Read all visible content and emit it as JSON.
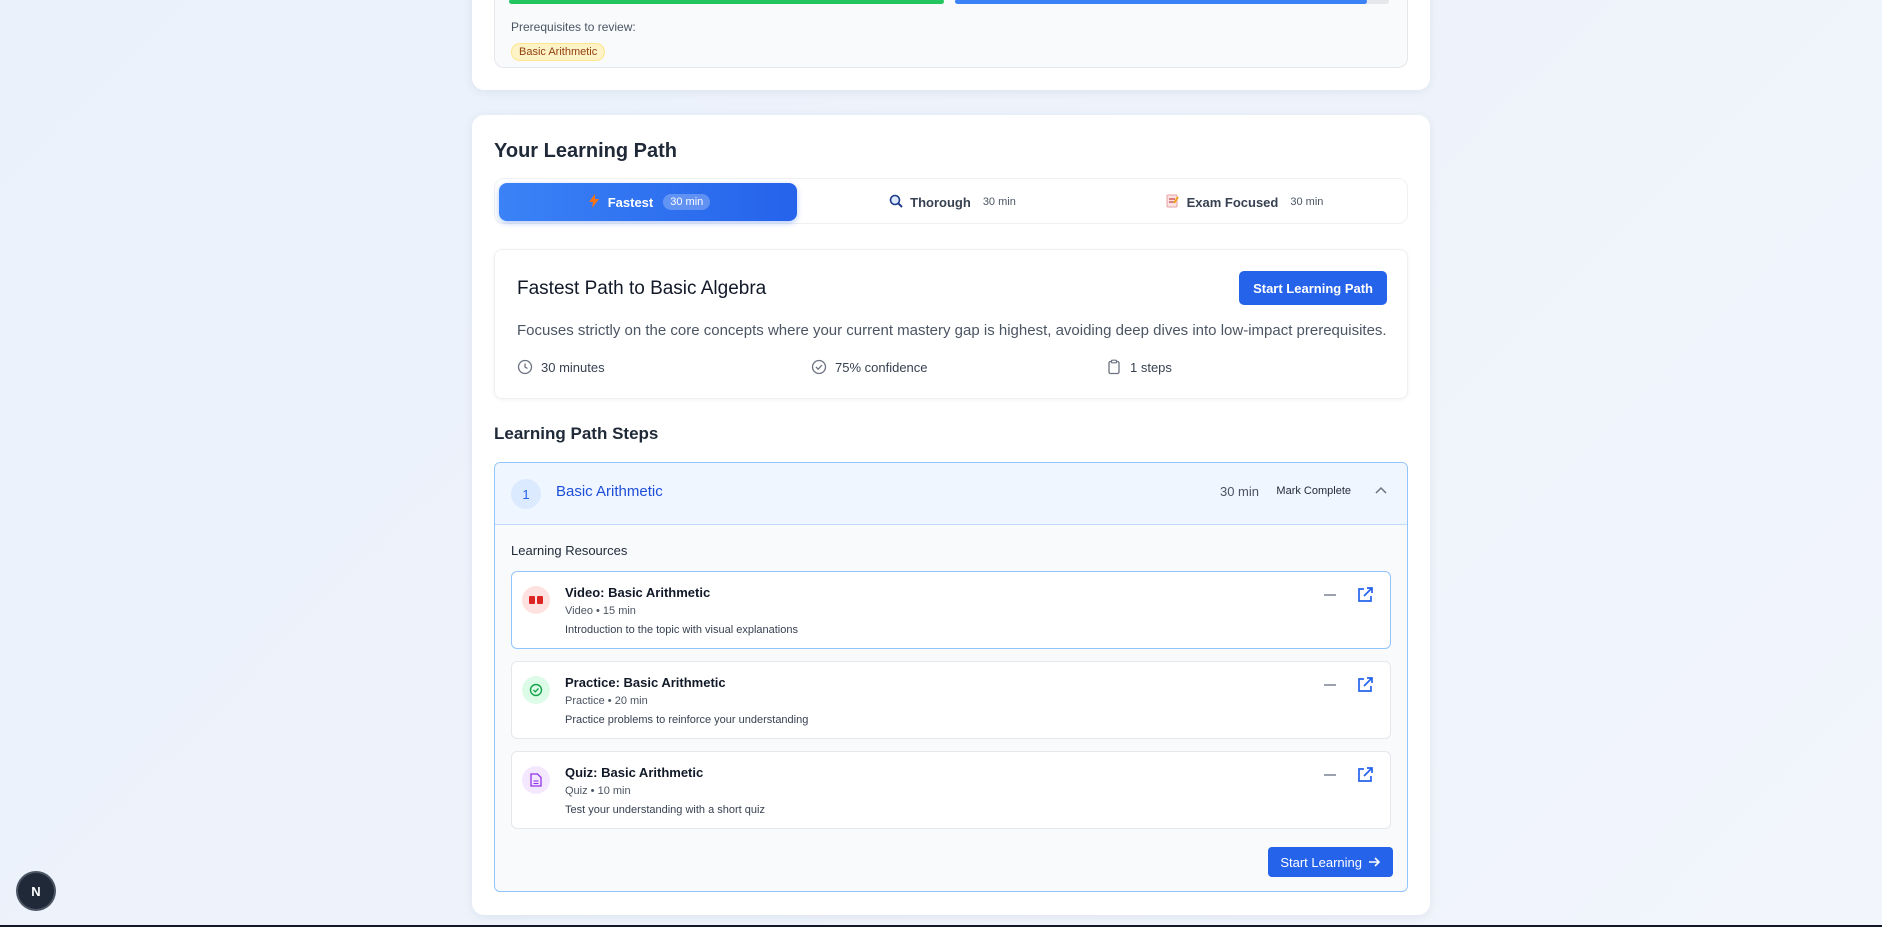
{
  "prerequisites": {
    "label": "Prerequisites to review:",
    "tags": [
      "Basic Arithmetic"
    ],
    "progress_green": 1.0,
    "progress_blue": 0.95
  },
  "learning_path": {
    "title": "Your Learning Path",
    "tabs": [
      {
        "label": "Fastest",
        "time": "30 min",
        "icon": "lightning-icon",
        "active": true
      },
      {
        "label": "Thorough",
        "time": "30 min",
        "icon": "magnifier-icon",
        "active": false
      },
      {
        "label": "Exam Focused",
        "time": "30 min",
        "icon": "memo-icon",
        "active": false
      }
    ]
  },
  "path": {
    "title": "Fastest Path to Basic Algebra",
    "start_button": "Start Learning Path",
    "description": "Focuses strictly on the core concepts where your current mastery gap is highest, avoiding deep dives into low-impact prerequisites.",
    "duration": "30 minutes",
    "confidence": "75% confidence",
    "steps_count": "1 steps"
  },
  "steps": {
    "title": "Learning Path Steps",
    "items": [
      {
        "number": "1",
        "name": "Basic Arithmetic",
        "time": "30 min",
        "mark_complete": "Mark Complete",
        "resources_label": "Learning Resources",
        "resources": [
          {
            "title": "Video: Basic Arithmetic",
            "meta": "Video • 15 min",
            "description": "Introduction to the topic with visual explanations",
            "icon": "video-icon"
          },
          {
            "title": "Practice: Basic Arithmetic",
            "meta": "Practice • 20 min",
            "description": "Practice problems to reinforce your understanding",
            "icon": "check-circle-icon"
          },
          {
            "title": "Quiz: Basic Arithmetic",
            "meta": "Quiz • 10 min",
            "description": "Test your understanding with a short quiz",
            "icon": "document-icon"
          }
        ],
        "start_button": "Start Learning"
      }
    ]
  },
  "dev_badge": "N",
  "colors": {
    "primary": "#2563eb",
    "success": "#22c55e",
    "warning_bg": "#fef3c7"
  }
}
